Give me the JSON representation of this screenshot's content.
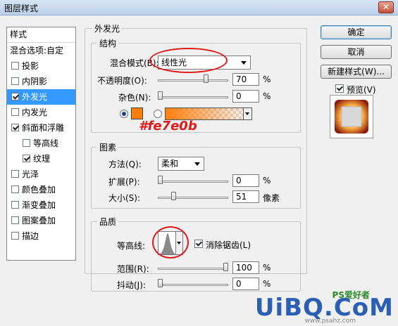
{
  "window": {
    "title": "图层样式",
    "close_glyph": "✕"
  },
  "left_panel": {
    "header": "样式",
    "items": [
      {
        "label": "混合选项:自定",
        "checkbox": false,
        "checked": false,
        "indent": 0,
        "selected": false
      },
      {
        "label": "投影",
        "checkbox": true,
        "checked": false,
        "indent": 0,
        "selected": false
      },
      {
        "label": "内阴影",
        "checkbox": true,
        "checked": false,
        "indent": 0,
        "selected": false
      },
      {
        "label": "外发光",
        "checkbox": true,
        "checked": true,
        "indent": 0,
        "selected": true
      },
      {
        "label": "内发光",
        "checkbox": true,
        "checked": false,
        "indent": 0,
        "selected": false
      },
      {
        "label": "斜面和浮雕",
        "checkbox": true,
        "checked": true,
        "indent": 0,
        "selected": false
      },
      {
        "label": "等高线",
        "checkbox": true,
        "checked": false,
        "indent": 1,
        "selected": false
      },
      {
        "label": "纹理",
        "checkbox": true,
        "checked": true,
        "indent": 1,
        "selected": false
      },
      {
        "label": "光泽",
        "checkbox": true,
        "checked": false,
        "indent": 0,
        "selected": false
      },
      {
        "label": "颜色叠加",
        "checkbox": true,
        "checked": false,
        "indent": 0,
        "selected": false
      },
      {
        "label": "渐变叠加",
        "checkbox": true,
        "checked": false,
        "indent": 0,
        "selected": false
      },
      {
        "label": "图案叠加",
        "checkbox": true,
        "checked": false,
        "indent": 0,
        "selected": false
      },
      {
        "label": "描边",
        "checkbox": true,
        "checked": false,
        "indent": 0,
        "selected": false
      }
    ]
  },
  "outer_glow": {
    "title": "外发光",
    "structure": {
      "title": "结构",
      "blend_mode_label": "混合模式(B):",
      "blend_mode_value": "线性光",
      "opacity_label": "不透明度(O):",
      "opacity_value": "70",
      "opacity_unit": "%",
      "opacity_fraction": 0.7,
      "noise_label": "杂色(N):",
      "noise_value": "0",
      "noise_unit": "%",
      "noise_fraction": 0,
      "glow_color": "#fe7e0b",
      "color_annotation": "#fe7e0b"
    },
    "elements": {
      "title": "图素",
      "technique_label": "方法(Q):",
      "technique_value": "柔和",
      "spread_label": "扩展(P):",
      "spread_value": "0",
      "spread_unit": "%",
      "spread_fraction": 0,
      "size_label": "大小(S):",
      "size_value": "51",
      "size_unit": "像素",
      "size_fraction": 0.2
    },
    "quality": {
      "title": "品质",
      "contour_label": "等高线:",
      "antialias_label": "消除锯齿(L)",
      "antialias_checked": true,
      "range_label": "范围(R):",
      "range_value": "100",
      "range_unit": "%",
      "range_fraction": 1,
      "jitter_label": "抖动(J):",
      "jitter_value": "0",
      "jitter_unit": "%",
      "jitter_fraction": 0
    }
  },
  "buttons": {
    "ok": "确定",
    "cancel": "取消",
    "new_style": "新建样式(W)..."
  },
  "preview": {
    "label": "预览(V)",
    "checked": true
  },
  "watermark": {
    "main": "UiBQ.CoM",
    "small": "PS爱好者",
    "site": "www.psahz.com"
  },
  "colors": {
    "annotation_red": "#e01818",
    "selection_blue": "#3399ff"
  }
}
